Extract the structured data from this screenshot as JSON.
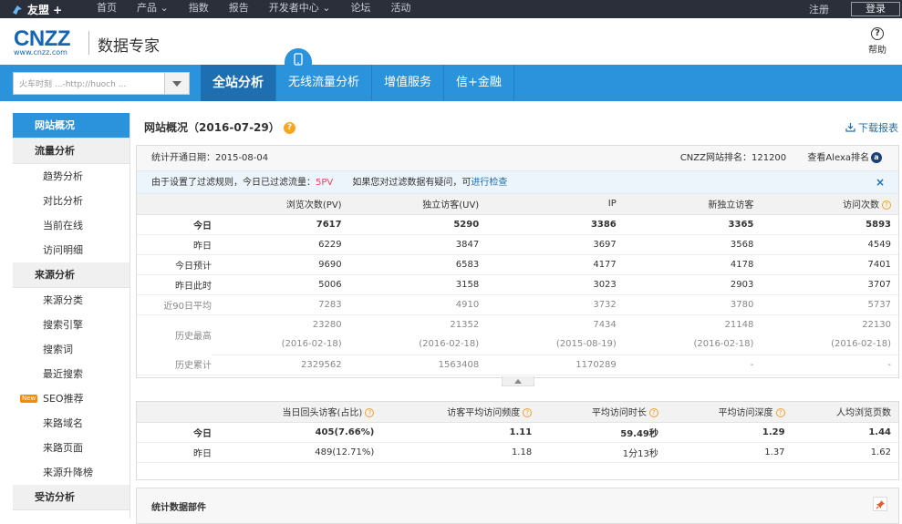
{
  "topbar": {
    "logo": "友盟 +",
    "nav": [
      "首页",
      "产品",
      "指数",
      "报告",
      "开发者中心",
      "论坛",
      "活动"
    ],
    "register": "注册",
    "login": "登录"
  },
  "header": {
    "brand": "CNZZ",
    "brand_url": "www.cnzz.com",
    "title": "数据专家",
    "help": "帮助"
  },
  "bluebar": {
    "search_value": "火车时刻 ...-http://huoch ...",
    "tabs": [
      "全站分析",
      "无线流量分析",
      "增值服务",
      "信+金融"
    ]
  },
  "sidebar": {
    "overview": "网站概况",
    "groups": [
      {
        "title": "流量分析",
        "items": [
          "趋势分析",
          "对比分析",
          "当前在线",
          "访问明细"
        ]
      },
      {
        "title": "来源分析",
        "items": [
          "来源分类",
          "搜索引擎",
          "搜索词",
          "最近搜索",
          "SEO推荐",
          "来路域名",
          "来路页面",
          "来源升降榜"
        ]
      },
      {
        "title": "受访分析",
        "items": []
      }
    ],
    "new_badge": "New"
  },
  "main": {
    "title": "网站概况（2016-07-29）",
    "download": "下载报表",
    "info": {
      "start_date": "统计开通日期：2015-08-04",
      "rank": "CNZZ网站排名：121200",
      "alexa": "查看Alexa排名"
    },
    "filter": {
      "text1": "由于设置了过滤规则，今日已过滤流量：",
      "value": "5PV",
      "text2": "如果您对过滤数据有疑问，可",
      "link": "进行检查",
      "close": "×"
    },
    "table1": {
      "headers": [
        "",
        "浏览次数(PV)",
        "独立访客(UV)",
        "IP",
        "新独立访客",
        "访问次数"
      ],
      "rows": [
        {
          "label": "今日",
          "cells": [
            "7617",
            "5290",
            "3386",
            "3365",
            "5893"
          ]
        },
        {
          "label": "昨日",
          "cells": [
            "6229",
            "3847",
            "3697",
            "3568",
            "4549"
          ]
        },
        {
          "label": "今日预计",
          "cells": [
            "9690",
            "6583",
            "4177",
            "4178",
            "7401"
          ]
        },
        {
          "label": "昨日此时",
          "cells": [
            "5006",
            "3158",
            "3023",
            "2903",
            "3707"
          ]
        },
        {
          "label": "近90日平均",
          "cells": [
            "7283",
            "4910",
            "3732",
            "3780",
            "5737"
          ]
        },
        {
          "label": "历史最高",
          "cells": [
            "23280",
            "21352",
            "7434",
            "21148",
            "22130"
          ],
          "dates": [
            "(2016-02-18)",
            "(2016-02-18)",
            "(2015-08-19)",
            "(2016-02-18)",
            "(2016-02-18)"
          ]
        },
        {
          "label": "历史累计",
          "cells": [
            "2329562",
            "1563408",
            "1170289",
            "-",
            "-"
          ]
        }
      ]
    },
    "table2": {
      "headers": [
        "",
        "当日回头访客(占比)",
        "访客平均访问频度",
        "平均访问时长",
        "平均访问深度",
        "人均浏览页数"
      ],
      "rows": [
        {
          "label": "今日",
          "cells": [
            "405(7.66%)",
            "1.11",
            "59.49秒",
            "1.29",
            "1.44"
          ]
        },
        {
          "label": "昨日",
          "cells": [
            "489(12.71%)",
            "1.18",
            "1分13秒",
            "1.37",
            "1.62"
          ]
        }
      ]
    },
    "widgets_title": "统计数据部件"
  }
}
